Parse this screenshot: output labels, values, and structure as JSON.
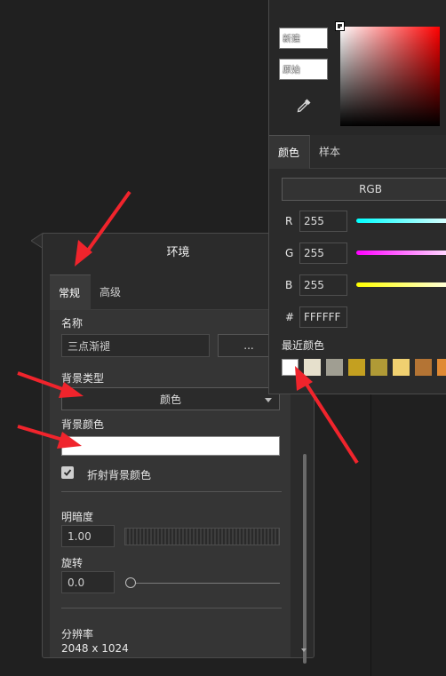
{
  "environment_panel": {
    "title": "环境",
    "tabs": [
      {
        "label": "常规"
      },
      {
        "label": "高级"
      }
    ],
    "name_label": "名称",
    "name_value": "三点渐褪",
    "browse_label": "...",
    "bg_type_label": "背景类型",
    "bg_type_value": "颜色",
    "bg_color_label": "背景颜色",
    "bg_color_value": "#ffffff",
    "refract_label": "折射背景颜色",
    "refract_checked": true,
    "brightness_label": "明暗度",
    "brightness_value": "1.00",
    "rotation_label": "旋转",
    "rotation_value": "0.0",
    "resolution_label": "分辨率",
    "resolution_value": "2048 x 1024"
  },
  "color_picker": {
    "new_label": "新建",
    "original_label": "原始",
    "new_color": "#ffffff",
    "original_color": "#ffffff",
    "hue_color": "#ff0000",
    "tabs": [
      {
        "label": "颜色"
      },
      {
        "label": "样本"
      }
    ],
    "mode_label": "RGB",
    "channels": [
      {
        "label": "R",
        "value": "255"
      },
      {
        "label": "G",
        "value": "255"
      },
      {
        "label": "B",
        "value": "255"
      }
    ],
    "hex_label": "#",
    "hex_value": "FFFFFF",
    "recent_label": "最近颜色",
    "recent_colors": [
      "#ffffff",
      "#e6e0cc",
      "#a09e92",
      "#c4a020",
      "#b09a36",
      "#f0d070",
      "#b47434",
      "#e08a34"
    ]
  },
  "annotation_color": "#f0242c"
}
